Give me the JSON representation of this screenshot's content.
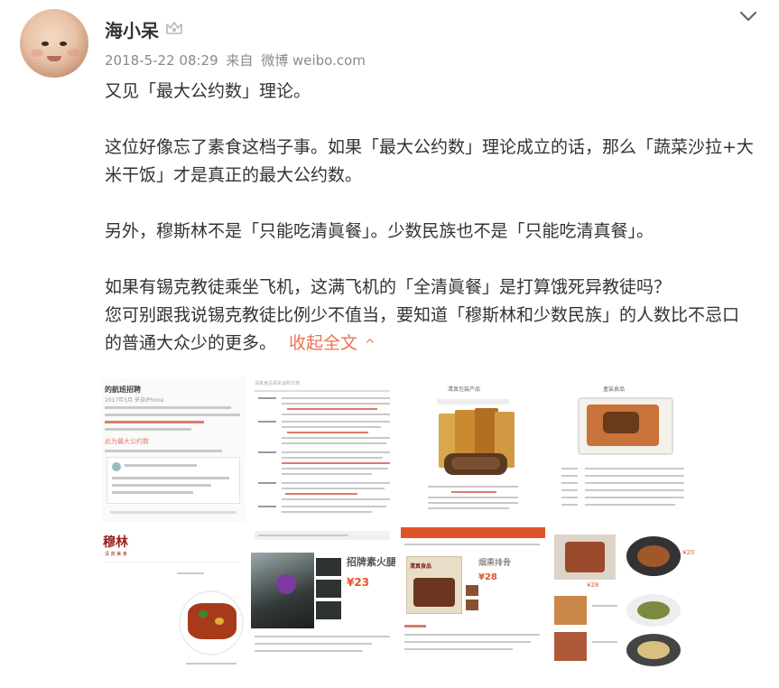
{
  "post": {
    "username": "海小呆",
    "timestamp": "2018-5-22 08:29",
    "source_prefix": "来自",
    "source": "微博 weibo.com",
    "paragraphs": [
      "又见「最大公约数」理论。",
      "这位好像忘了素食这档子事。如果「最大公约数」理论成立的话，那么「蔬菜沙拉+大米干饭」才是真正的最大公约数。",
      "另外，穆斯林不是「只能吃清眞餐」。少数民族也不是「只能吃清真餐」。",
      "如果有锡克教徒乘坐飞机，这满飞机的「全清眞餐」是打算饿死异教徒吗？",
      "您可别跟我说锡克教徒比例少不值当，要知道「穆斯林和少数民族」的人数比不忌口的普通大众少的更多。"
    ],
    "collapse_label": "收起全文",
    "collapse_chevron": "^"
  },
  "thumbnails": {
    "t1_lines": [
      "的航班招聘",
      "2017年5月 来自iPhone",
      "关于航空公司清真餐的讨论",
      "应该全部采用清真餐标准",
      "此为最大公约数"
    ],
    "t2_header": "清真食品相关说明文档",
    "t3_title": "清真包装产品",
    "t4_title": "盒装食品",
    "t5_brand": "穆林",
    "t5_sub": "清 真 美 食",
    "t6_title": "招牌素火腿",
    "t6_price": "¥23",
    "t7_title": "烟熏排骨",
    "t7_price": "¥28",
    "t7_package": "清真食品",
    "t8_prices": [
      "¥28",
      "¥20"
    ]
  },
  "colors": {
    "accent": "#eb7350",
    "meta_gray": "#8a8a8a",
    "text": "#333333"
  }
}
